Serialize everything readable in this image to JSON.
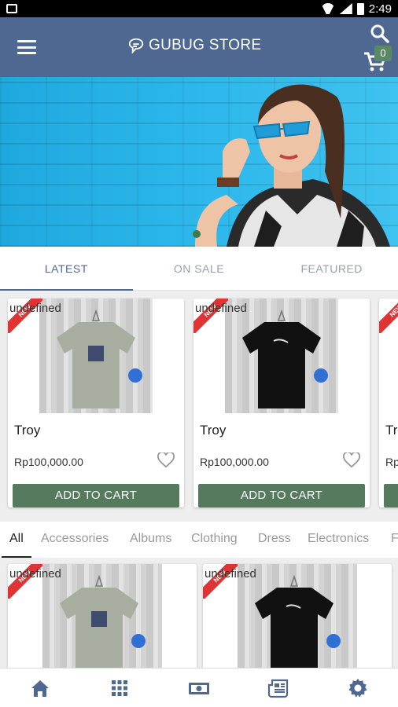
{
  "statusbar": {
    "time": "2:49"
  },
  "appbar": {
    "title": "GUBUG STORE",
    "cart_count": "0"
  },
  "tabs": [
    {
      "label": "LATEST",
      "active": true
    },
    {
      "label": "ON SALE",
      "active": false
    },
    {
      "label": "FEATURED",
      "active": false
    }
  ],
  "products": [
    {
      "name": "Troy",
      "price": "Rp100,000.00",
      "badge": "NEW",
      "note": "undefined",
      "shirt_color": "#a7ae9f",
      "button": "ADD TO CART"
    },
    {
      "name": "Troy",
      "price": "Rp100,000.00",
      "badge": "NEW",
      "note": "undefined",
      "shirt_color": "#111111",
      "button": "ADD TO CART"
    },
    {
      "name": "Tro",
      "price": "Rp",
      "badge": "NEW",
      "note": "",
      "shirt_color": "#cccccc",
      "button": ""
    }
  ],
  "categories": [
    {
      "label": "All",
      "active": true
    },
    {
      "label": "Accessories",
      "active": false
    },
    {
      "label": "Albums",
      "active": false
    },
    {
      "label": "Clothing",
      "active": false
    },
    {
      "label": "Dress",
      "active": false
    },
    {
      "label": "Electronics",
      "active": false
    },
    {
      "label": "F",
      "active": false
    }
  ],
  "grid_products": [
    {
      "badge": "NEW",
      "note": "undefined",
      "shirt_color": "#a7ae9f"
    },
    {
      "badge": "NEW",
      "note": "undefined",
      "shirt_color": "#111111"
    }
  ],
  "bottom_nav": [
    "home-icon",
    "grid-icon",
    "money-icon",
    "news-icon",
    "settings-icon"
  ],
  "colors": {
    "primary": "#4f6891",
    "button_green": "#557a5d",
    "badge_red": "#e03434"
  }
}
